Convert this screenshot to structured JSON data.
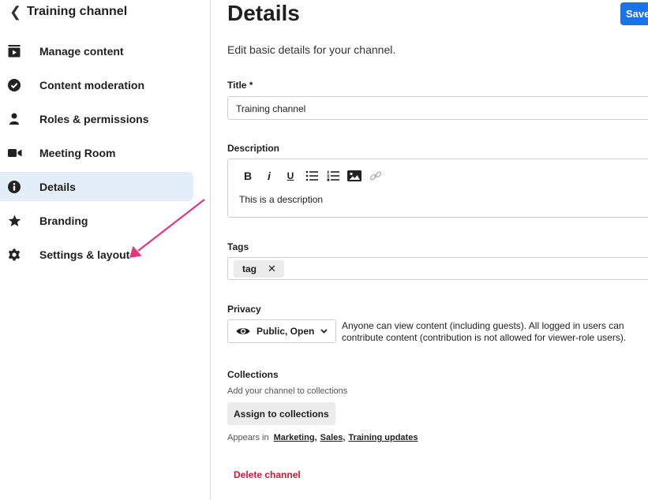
{
  "sidebar": {
    "back_label": "Training channel",
    "items": [
      {
        "label": "Manage content",
        "icon": "play-icon"
      },
      {
        "label": "Content moderation",
        "icon": "check-circle-icon"
      },
      {
        "label": "Roles & permissions",
        "icon": "user-icon"
      },
      {
        "label": "Meeting Room",
        "icon": "video-camera-icon"
      },
      {
        "label": "Details",
        "icon": "info-icon",
        "active": true
      },
      {
        "label": "Branding",
        "icon": "star-icon"
      },
      {
        "label": "Settings & layout",
        "icon": "gear-icon"
      }
    ]
  },
  "main": {
    "title": "Details",
    "save_label": "Save",
    "subtitle": "Edit basic details for your channel.",
    "title_field": {
      "label": "Title *",
      "value": "Training channel"
    },
    "description": {
      "label": "Description",
      "value": "This is a description",
      "toolbar": [
        "B",
        "i",
        "U"
      ]
    },
    "tags": {
      "label": "Tags",
      "items": [
        "tag"
      ],
      "remove_glyph": "✕"
    },
    "privacy": {
      "label": "Privacy",
      "selected": "Public, Open",
      "description": "Anyone can view content (including guests). All logged in users can contribute content (contribution is not allowed for viewer-role users)."
    },
    "collections": {
      "label": "Collections",
      "helper": "Add your channel to collections",
      "assign_label": "Assign to collections",
      "appears_prefix": "Appears in",
      "links": [
        "Marketing,",
        "Sales,",
        "Training updates"
      ]
    },
    "delete_label": "Delete channel"
  },
  "colors": {
    "accent": "#1a73e8",
    "active_bg": "#e4eef9",
    "danger": "#c21f35",
    "annotation_arrow": "#e5357b"
  }
}
